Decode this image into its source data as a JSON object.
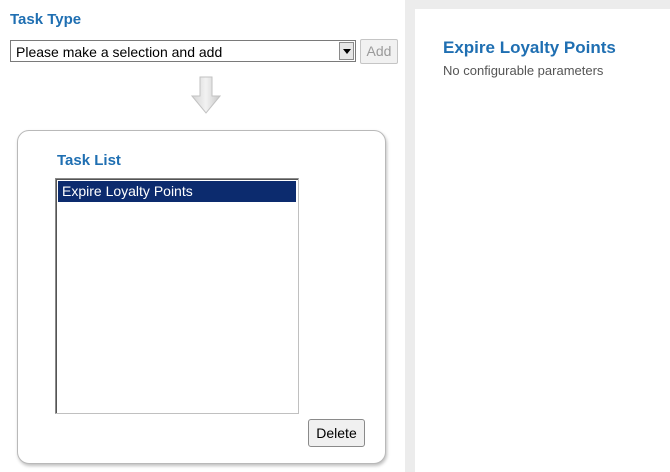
{
  "task_type": {
    "title": "Task Type",
    "select_value": "Please make a selection and add",
    "add_label": "Add"
  },
  "task_list": {
    "title": "Task List",
    "items": [
      "Expire Loyalty Points"
    ],
    "delete_label": "Delete"
  },
  "details": {
    "title": "Expire Loyalty Points",
    "subtitle": "No configurable parameters"
  },
  "icons": {
    "select_arrow": "chevron-down-icon",
    "flow_arrow": "arrow-down-icon"
  },
  "colors": {
    "heading": "#1f6fb2",
    "selected_item_bg": "#0c2b6e",
    "right_panel_bg": "#ececec"
  }
}
